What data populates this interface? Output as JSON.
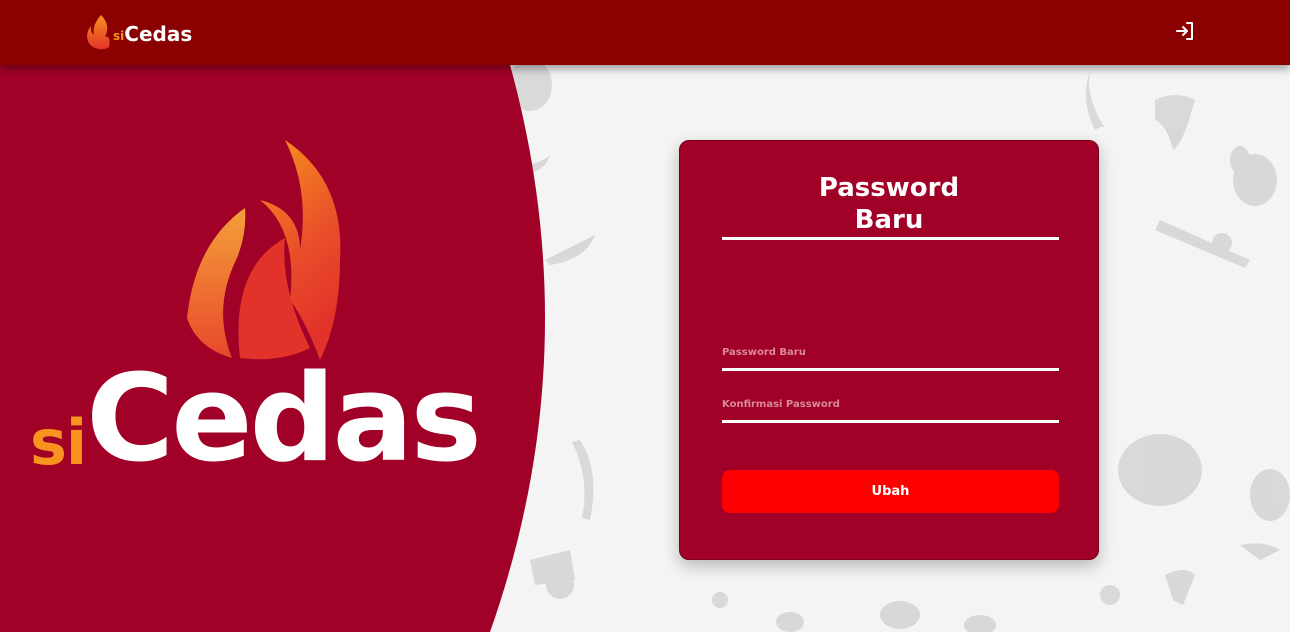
{
  "navbar": {
    "brand_prefix": "si",
    "brand_name": "Cedas",
    "login_icon": "login-arrow-icon"
  },
  "hero": {
    "logo_prefix": "si",
    "logo_name": "Cedas"
  },
  "form": {
    "title": "Password Baru",
    "new_password_label": "Password Baru",
    "confirm_password_label": "Konfirmasi Password",
    "new_password_value": "",
    "confirm_password_value": "",
    "submit_label": "Ubah"
  },
  "colors": {
    "navbar": "#8b0000",
    "hero": "#a10027",
    "card": "#a10027",
    "button": "#ff0000",
    "accent_orange": "#f7931e"
  }
}
